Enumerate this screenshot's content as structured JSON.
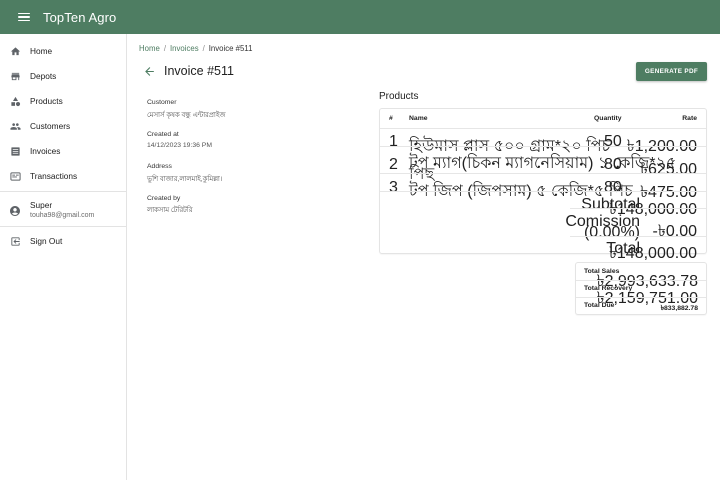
{
  "app": {
    "title": "TopTen Agro"
  },
  "sidebar": {
    "items": [
      {
        "label": "Home",
        "icon": "home-icon"
      },
      {
        "label": "Depots",
        "icon": "store-icon"
      },
      {
        "label": "Products",
        "icon": "shapes-icon"
      },
      {
        "label": "Customers",
        "icon": "people-icon"
      },
      {
        "label": "Invoices",
        "icon": "list-icon"
      },
      {
        "label": "Transactions",
        "icon": "card-icon"
      }
    ],
    "user": {
      "name": "Super",
      "email": "touha98@gmail.com"
    },
    "signout": "Sign Out"
  },
  "breadcrumb": {
    "home": "Home",
    "invoices": "Invoices",
    "current": "Invoice #511"
  },
  "page": {
    "title": "Invoice #511",
    "generate_pdf": "GENERATE PDF"
  },
  "meta": {
    "customer_label": "Customer",
    "customer_value": "মেসার্স কৃষক বন্ধু এন্টারপ্রাইজ",
    "created_at_label": "Created at",
    "created_at_value": "14/12/2023 19:36 PM",
    "address_label": "Address",
    "address_value": "ভুশি বাজার,লালমাই,কুমিল্লা।",
    "created_by_label": "Created by",
    "created_by_value": "লাকসাম টেরিটরি"
  },
  "products": {
    "title": "Products",
    "headers": {
      "num": "#",
      "name": "Name",
      "quantity": "Quantity",
      "rate": "Rate"
    },
    "rows": [
      {
        "num": "1",
        "name": "হিউমাস প্লাস ৫০০ গ্রাম*২০ পিচ",
        "quantity": "50",
        "rate": "৳1,200.00"
      },
      {
        "num": "2",
        "name": "টপ ম্যাগ(চিকন ম্যাগনেসিয়াম) ১ কেজি*২৫",
        "name2": "পিছ",
        "quantity": "80",
        "rate": "৳625.00"
      },
      {
        "num": "3",
        "name": "টপ জিপ (জিপসাম) ৫ কেজি*৫ পিচ",
        "quantity": "80",
        "rate": "৳475.00"
      }
    ],
    "subtotal_label": "Subtotal",
    "subtotal_value": "৳148,000.00",
    "commission_label": "Comission",
    "commission_pct": "(0.00%)",
    "commission_value": "-৳0.00",
    "total_label": "Total",
    "total_value": "৳148,000.00"
  },
  "summary": {
    "sales_label": "Total Sales",
    "sales_value": "৳2,993,633.78",
    "recovery_label": "Total Recovery",
    "recovery_value": "৳2,159,751.00",
    "due_label": "Total Due",
    "due_value": "৳833,882.78"
  },
  "colors": {
    "primary": "#4e7d62",
    "icon": "#5f6368"
  }
}
